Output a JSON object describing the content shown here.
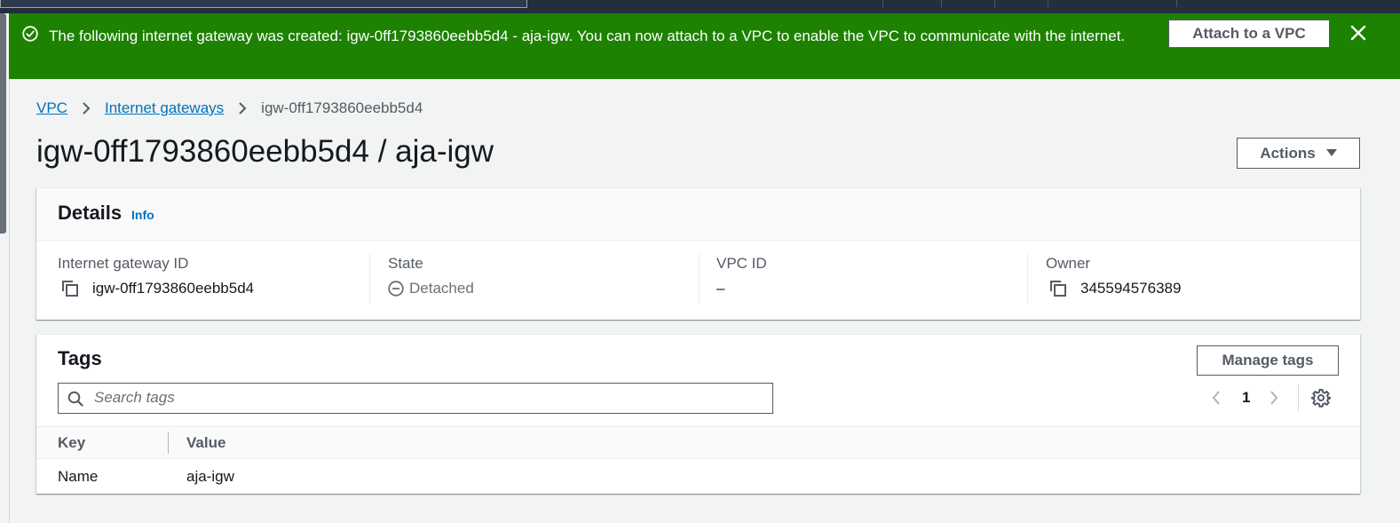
{
  "colors": {
    "success": "#1d8102",
    "link": "#0073bb",
    "text": "#16191f",
    "muted": "#545b64"
  },
  "flash": {
    "message": "The following internet gateway was created: igw-0ff1793860eebb5d4 - aja-igw. You can now attach to a VPC to enable the VPC to communicate with the internet.",
    "attach_label": "Attach to a VPC",
    "icon": "check-circle-icon",
    "close_icon": "close-icon"
  },
  "breadcrumb": {
    "items": [
      "VPC",
      "Internet gateways"
    ],
    "current": "igw-0ff1793860eebb5d4"
  },
  "page": {
    "title": "igw-0ff1793860eebb5d4 / aja-igw",
    "actions_label": "Actions"
  },
  "details": {
    "heading": "Details",
    "info_label": "Info",
    "fields": [
      {
        "label": "Internet gateway ID",
        "value": "igw-0ff1793860eebb5d4"
      },
      {
        "label": "State",
        "value": "Detached"
      },
      {
        "label": "VPC ID",
        "value": "–"
      },
      {
        "label": "Owner",
        "value": "345594576389"
      }
    ]
  },
  "tags": {
    "heading": "Tags",
    "manage_label": "Manage tags",
    "search_placeholder": "Search tags",
    "page_number": "1",
    "columns": [
      "Key",
      "Value"
    ],
    "rows": [
      {
        "key": "Name",
        "value": "aja-igw"
      }
    ]
  }
}
